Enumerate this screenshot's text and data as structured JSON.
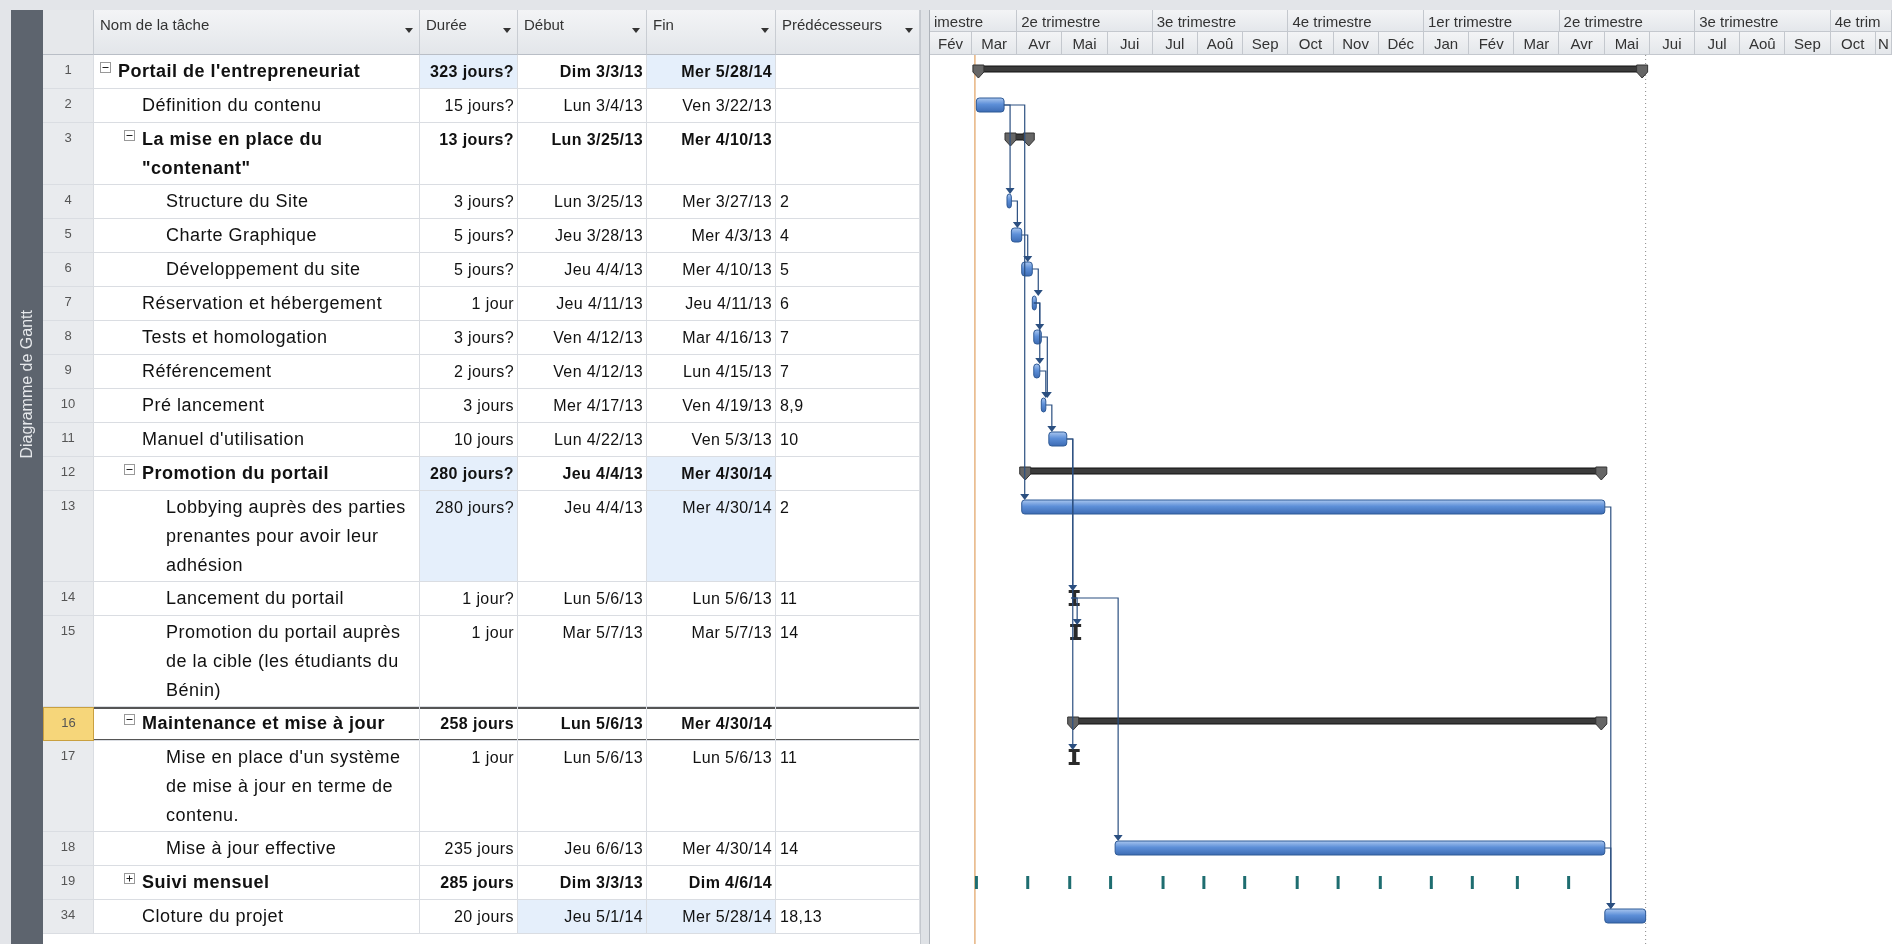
{
  "sidebar": {
    "label": "Diagramme de Gantt"
  },
  "columns": [
    {
      "label": "Nom de la tâche"
    },
    {
      "label": "Durée"
    },
    {
      "label": "Début"
    },
    {
      "label": "Fin"
    },
    {
      "label": "Prédécesseurs"
    }
  ],
  "timescale": {
    "quarters": [
      "imestre",
      "2e trimestre",
      "3e trimestre",
      "4e trimestre",
      "1er trimestre",
      "2e trimestre",
      "3e trimestre",
      "4e trim"
    ],
    "months": [
      "Fév",
      "Mar",
      "Avr",
      "Mai",
      "Jui",
      "Jul",
      "Aoû",
      "Sep",
      "Oct",
      "Nov",
      "Déc",
      "Jan",
      "Fév",
      "Mar",
      "Avr",
      "Mai",
      "Jui",
      "Jul",
      "Aoû",
      "Sep",
      "Oct",
      "N"
    ]
  },
  "tasks": [
    {
      "id": "1",
      "name": "Portail de l'entrepreneuriat",
      "kind": "summary",
      "expanded": true,
      "selected": false,
      "duration": {
        "text": "323 jours?",
        "highlighted": true
      },
      "start": {
        "text": "Dim 3/3/13",
        "highlighted": false
      },
      "finish": {
        "text": "Mer 5/28/14",
        "highlighted": true
      },
      "children": [
        {
          "id": "2",
          "name": "Définition du contenu",
          "kind": "task",
          "selected": false,
          "duration": {
            "text": "15 jours?",
            "highlighted": false
          },
          "start": {
            "text": "Lun 3/4/13",
            "highlighted": false
          },
          "finish": {
            "text": "Ven 3/22/13",
            "highlighted": false
          }
        },
        {
          "id": "3",
          "name": "La mise en place du \"contenant\"",
          "kind": "summary",
          "expanded": true,
          "selected": false,
          "duration": {
            "text": "13 jours?",
            "highlighted": false
          },
          "start": {
            "text": "Lun 3/25/13",
            "highlighted": false
          },
          "finish": {
            "text": "Mer 4/10/13",
            "highlighted": false
          },
          "children": [
            {
              "id": "4",
              "name": "Structure du Site",
              "kind": "task",
              "selected": false,
              "duration": {
                "text": "3 jours?",
                "highlighted": false
              },
              "start": {
                "text": "Lun 3/25/13",
                "highlighted": false
              },
              "finish": {
                "text": "Mer 3/27/13",
                "highlighted": false
              },
              "predecessors": "2"
            },
            {
              "id": "5",
              "name": "Charte Graphique",
              "kind": "task",
              "selected": false,
              "duration": {
                "text": "5 jours?",
                "highlighted": false
              },
              "start": {
                "text": "Jeu 3/28/13",
                "highlighted": false
              },
              "finish": {
                "text": "Mer 4/3/13",
                "highlighted": false
              },
              "predecessors": "4"
            },
            {
              "id": "6",
              "name": "Développement du site",
              "kind": "task",
              "selected": false,
              "duration": {
                "text": "5 jours?",
                "highlighted": false
              },
              "start": {
                "text": "Jeu 4/4/13",
                "highlighted": false
              },
              "finish": {
                "text": "Mer 4/10/13",
                "highlighted": false
              },
              "predecessors": "5"
            }
          ]
        },
        {
          "id": "7",
          "name": "Réservation et hébergement",
          "kind": "task",
          "selected": false,
          "duration": {
            "text": "1 jour",
            "highlighted": false
          },
          "start": {
            "text": "Jeu 4/11/13",
            "highlighted": false
          },
          "finish": {
            "text": "Jeu 4/11/13",
            "highlighted": false
          },
          "predecessors": "6"
        },
        {
          "id": "8",
          "name": "Tests et homologation",
          "kind": "task",
          "selected": false,
          "duration": {
            "text": "3 jours?",
            "highlighted": false
          },
          "start": {
            "text": "Ven 4/12/13",
            "highlighted": false
          },
          "finish": {
            "text": "Mar 4/16/13",
            "highlighted": false
          },
          "predecessors": "7"
        },
        {
          "id": "9",
          "name": "Référencement",
          "kind": "task",
          "selected": false,
          "duration": {
            "text": "2 jours?",
            "highlighted": false
          },
          "start": {
            "text": "Ven 4/12/13",
            "highlighted": false
          },
          "finish": {
            "text": "Lun 4/15/13",
            "highlighted": false
          },
          "predecessors": "7"
        },
        {
          "id": "10",
          "name": "Pré lancement",
          "kind": "task",
          "selected": false,
          "duration": {
            "text": "3 jours",
            "highlighted": false
          },
          "start": {
            "text": "Mer 4/17/13",
            "highlighted": false
          },
          "finish": {
            "text": "Ven 4/19/13",
            "highlighted": false
          },
          "predecessors": "8,9"
        },
        {
          "id": "11",
          "name": "Manuel d'utilisation",
          "kind": "task",
          "selected": false,
          "duration": {
            "text": "10 jours",
            "highlighted": false
          },
          "start": {
            "text": "Lun 4/22/13",
            "highlighted": false
          },
          "finish": {
            "text": "Ven 5/3/13",
            "highlighted": false
          },
          "predecessors": "10"
        },
        {
          "id": "12",
          "name": "Promotion du portail",
          "kind": "summary",
          "expanded": true,
          "selected": false,
          "duration": {
            "text": "280 jours?",
            "highlighted": true
          },
          "start": {
            "text": "Jeu 4/4/13",
            "highlighted": false
          },
          "finish": {
            "text": "Mer 4/30/14",
            "highlighted": true
          },
          "children": [
            {
              "id": "13",
              "name": "Lobbying auprès des parties prenantes pour avoir leur adhésion",
              "kind": "task",
              "selected": false,
              "duration": {
                "text": "280 jours?",
                "highlighted": true
              },
              "start": {
                "text": "Jeu 4/4/13",
                "highlighted": false
              },
              "finish": {
                "text": "Mer 4/30/14",
                "highlighted": true
              },
              "predecessors": "2"
            },
            {
              "id": "14",
              "name": "Lancement du portail",
              "kind": "manual",
              "selected": false,
              "duration": {
                "text": "1 jour?",
                "highlighted": false
              },
              "start": {
                "text": "Lun 5/6/13",
                "highlighted": false
              },
              "finish": {
                "text": "Lun 5/6/13",
                "highlighted": false
              },
              "predecessors": "11"
            },
            {
              "id": "15",
              "name": "Promotion du portail auprès de la cible (les étudiants du Bénin)",
              "kind": "manual",
              "selected": false,
              "duration": {
                "text": "1 jour",
                "highlighted": false
              },
              "start": {
                "text": "Mar 5/7/13",
                "highlighted": false
              },
              "finish": {
                "text": "Mar 5/7/13",
                "highlighted": false
              },
              "predecessors": "14"
            }
          ]
        },
        {
          "id": "16",
          "name": "Maintenance et mise à jour",
          "kind": "summary",
          "expanded": true,
          "selected": true,
          "duration": {
            "text": "258 jours",
            "highlighted": false
          },
          "start": {
            "text": "Lun 5/6/13",
            "highlighted": false
          },
          "finish": {
            "text": "Mer 4/30/14",
            "highlighted": false
          },
          "children": [
            {
              "id": "17",
              "name": "Mise en place d'un système de mise à jour en terme de contenu.",
              "kind": "manual",
              "selected": false,
              "duration": {
                "text": "1 jour",
                "highlighted": false
              },
              "start": {
                "text": "Lun 5/6/13",
                "highlighted": false
              },
              "finish": {
                "text": "Lun 5/6/13",
                "highlighted": false
              },
              "predecessors": "11"
            },
            {
              "id": "18",
              "name": "Mise à jour effective",
              "kind": "task",
              "selected": false,
              "duration": {
                "text": "235 jours",
                "highlighted": false
              },
              "start": {
                "text": "Jeu 6/6/13",
                "highlighted": false
              },
              "finish": {
                "text": "Mer 4/30/14",
                "highlighted": false
              },
              "predecessors": "14"
            }
          ]
        },
        {
          "id": "19",
          "name": "Suivi mensuel",
          "kind": "recurring",
          "expanded": false,
          "selected": false,
          "duration": {
            "text": "285 jours",
            "highlighted": false
          },
          "start": {
            "text": "Dim 3/3/13",
            "highlighted": false
          },
          "finish": {
            "text": "Dim 4/6/14",
            "highlighted": false
          }
        },
        {
          "id": "34",
          "name": "Cloture du projet",
          "kind": "task",
          "selected": false,
          "duration": {
            "text": "20 jours",
            "highlighted": false
          },
          "start": {
            "text": "Jeu 5/1/14",
            "highlighted": true
          },
          "finish": {
            "text": "Mer 5/28/14",
            "highlighted": true
          },
          "predecessors": "18,13"
        }
      ]
    }
  ]
}
